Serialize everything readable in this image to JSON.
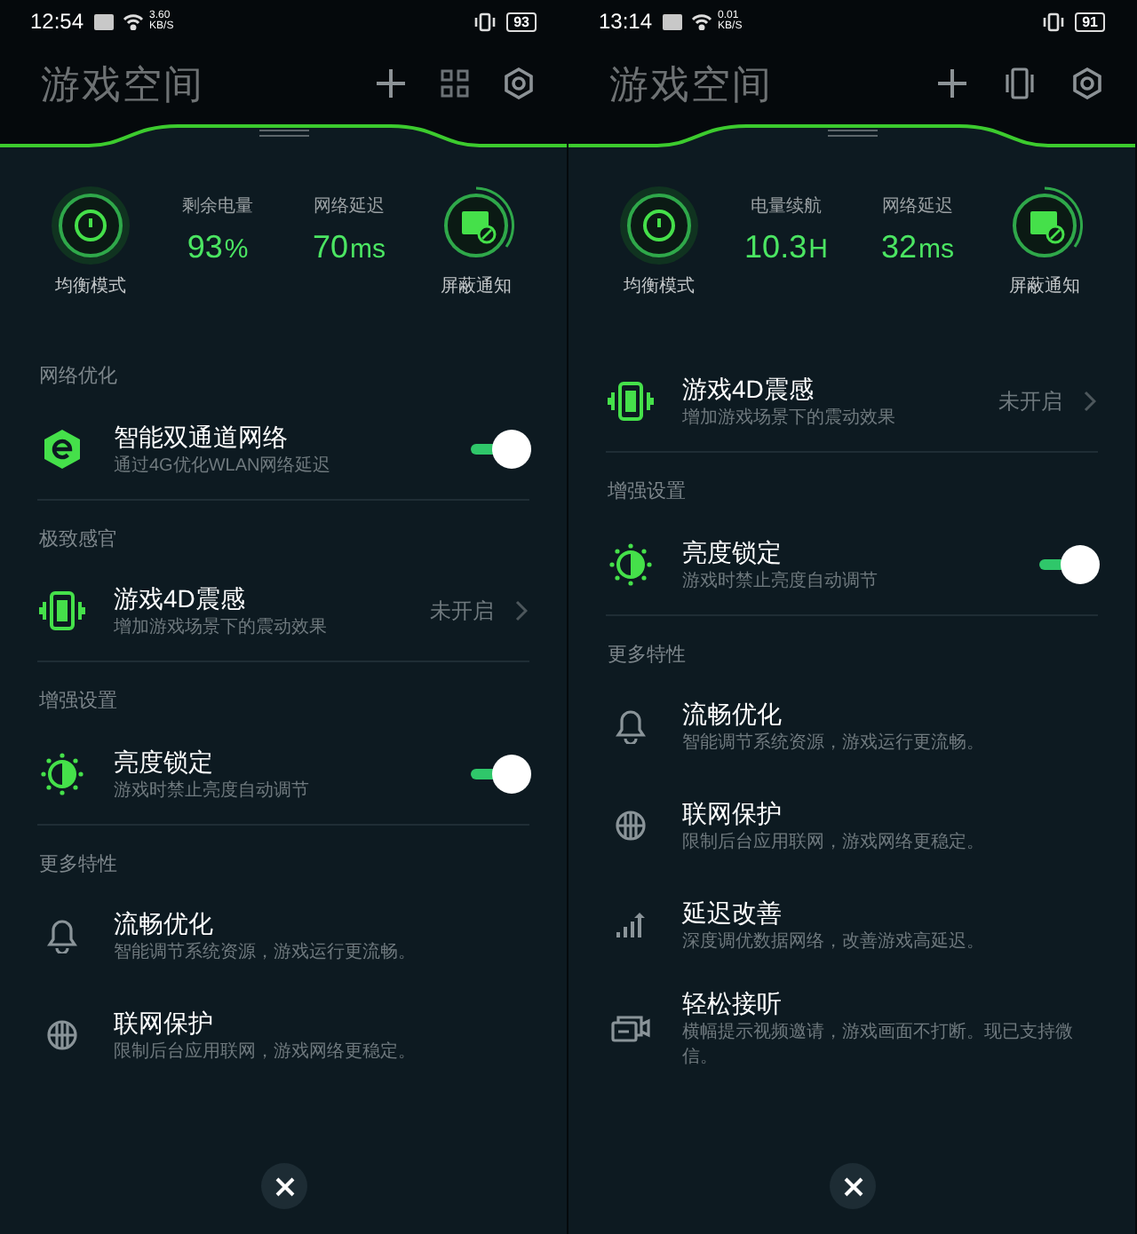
{
  "panels": [
    {
      "status_bar": {
        "time": "12:54",
        "net_speed": "3.60",
        "net_unit": "KB/S",
        "battery": "93"
      },
      "header": {
        "title": "游戏空间"
      },
      "stats": {
        "mode_label": "均衡模式",
        "items": [
          {
            "label": "剩余电量",
            "value": "93",
            "unit": "%"
          },
          {
            "label": "网络延迟",
            "value": "70",
            "unit": "ms"
          }
        ],
        "notify_label": "屏蔽通知"
      },
      "sections": [
        {
          "heading": "网络优化",
          "items": [
            {
              "kind": "toggle",
              "title": "智能双通道网络",
              "subtitle": "通过4G优化WLAN网络延迟",
              "on": true
            }
          ]
        },
        {
          "heading": "极致感官",
          "items": [
            {
              "kind": "link",
              "title": "游戏4D震感",
              "subtitle": "增加游戏场景下的震动效果",
              "value": "未开启"
            }
          ]
        },
        {
          "heading": "增强设置",
          "items": [
            {
              "kind": "toggle",
              "title": "亮度锁定",
              "subtitle": "游戏时禁止亮度自动调节",
              "on": true
            }
          ]
        },
        {
          "heading": "更多特性",
          "items": [
            {
              "kind": "plain",
              "title": "流畅优化",
              "subtitle": "智能调节系统资源，游戏运行更流畅。"
            },
            {
              "kind": "plain",
              "title": "联网保护",
              "subtitle": "限制后台应用联网，游戏网络更稳定。"
            }
          ]
        }
      ]
    },
    {
      "status_bar": {
        "time": "13:14",
        "net_speed": "0.01",
        "net_unit": "KB/S",
        "battery": "91"
      },
      "header": {
        "title": "游戏空间"
      },
      "stats": {
        "mode_label": "均衡模式",
        "items": [
          {
            "label": "电量续航",
            "value": "10.3",
            "unit": "H"
          },
          {
            "label": "网络延迟",
            "value": "32",
            "unit": "ms"
          }
        ],
        "notify_label": "屏蔽通知"
      },
      "sections": [
        {
          "items": [
            {
              "kind": "link",
              "title": "游戏4D震感",
              "subtitle": "增加游戏场景下的震动效果",
              "value": "未开启"
            }
          ]
        },
        {
          "heading": "增强设置",
          "items": [
            {
              "kind": "toggle",
              "title": "亮度锁定",
              "subtitle": "游戏时禁止亮度自动调节",
              "on": true
            }
          ]
        },
        {
          "heading": "更多特性",
          "items": [
            {
              "kind": "plain",
              "title": "流畅优化",
              "subtitle": "智能调节系统资源，游戏运行更流畅。"
            },
            {
              "kind": "plain",
              "title": "联网保护",
              "subtitle": "限制后台应用联网，游戏网络更稳定。"
            },
            {
              "kind": "plain",
              "title": "延迟改善",
              "subtitle": "深度调优数据网络，改善游戏高延迟。"
            },
            {
              "kind": "plain",
              "title": "轻松接听",
              "subtitle": "横幅提示视频邀请，游戏画面不打断。现已支持微信。"
            }
          ]
        }
      ]
    }
  ]
}
